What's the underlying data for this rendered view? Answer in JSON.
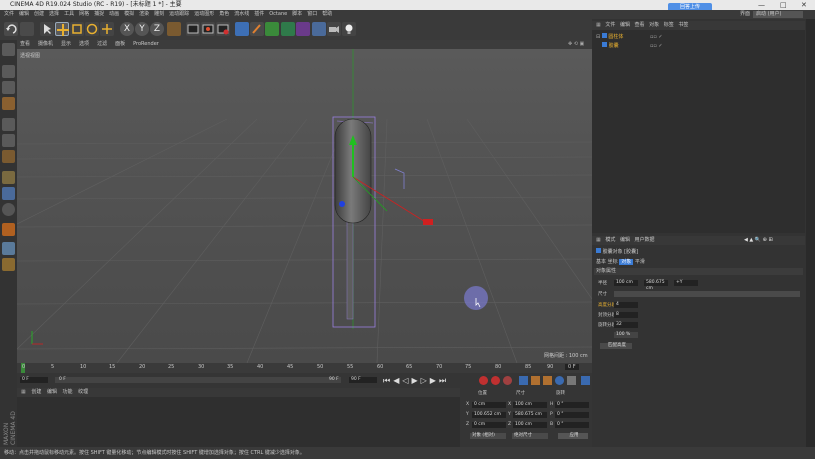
{
  "window": {
    "title": "CINEMA 4D R19.024 Studio (RC - R19) - [未标题 1 *] - 主要",
    "cloud_label": "回答上传"
  },
  "menubar": {
    "items": [
      "文件",
      "编辑",
      "创建",
      "选择",
      "工具",
      "网格",
      "捕捉",
      "动画",
      "模拟",
      "渲染",
      "雕刻",
      "运动跟踪",
      "运动图形",
      "角色",
      "流水线",
      "插件",
      "Octane",
      "脚本",
      "窗口",
      "帮助"
    ],
    "layout_label": "界面",
    "layout_value": "启动 (用户)"
  },
  "viewport": {
    "menu": [
      "查看",
      "摄像机",
      "显示",
      "选项",
      "过滤",
      "面板",
      "ProRender"
    ],
    "name": "透视视图",
    "grid_label": "网格间距 : 100 cm"
  },
  "timeline": {
    "ticks": [
      "0",
      "5",
      "10",
      "15",
      "20",
      "25",
      "30",
      "35",
      "40",
      "45",
      "50",
      "55",
      "60",
      "65",
      "70",
      "75",
      "80",
      "85",
      "90"
    ],
    "end_frame": "0 F",
    "start_field": "0 F",
    "min_field": "0 F",
    "max_field": "90 F",
    "end_field": "90 F"
  },
  "materials": {
    "menu": [
      "创建",
      "编辑",
      "功能",
      "纹理"
    ]
  },
  "coords": {
    "headers": [
      "位置",
      "尺寸",
      "旋转"
    ],
    "rows": [
      {
        "axis": "X",
        "pos": "0 cm",
        "size": "100 cm",
        "rot_label": "H",
        "rot": "0 °"
      },
      {
        "axis": "Y",
        "pos": "100.652 cm",
        "size": "580.675 cm",
        "rot_label": "P",
        "rot": "0 °"
      },
      {
        "axis": "Z",
        "pos": "0 cm",
        "size": "100 cm",
        "rot_label": "B",
        "rot": "0 °"
      }
    ],
    "mode1": "对象 (相对)",
    "mode2": "绝对尺寸",
    "apply": "应用"
  },
  "objects": {
    "menu": [
      "文件",
      "编辑",
      "查看",
      "对象",
      "标签",
      "书签"
    ],
    "items": [
      {
        "name": "圆柱体"
      },
      {
        "name": "胶囊"
      }
    ]
  },
  "attributes": {
    "menu": [
      "模式",
      "编辑",
      "用户数据"
    ],
    "header": "胶囊对象 [胶囊]",
    "tabs": [
      "基本",
      "坐标",
      "对象",
      "平滑"
    ],
    "section": "对象属性",
    "props": [
      {
        "label": "半径",
        "value": "100 cm"
      },
      {
        "label": "高度",
        "value": "580.675 cm"
      },
      {
        "label": "方向",
        "value": "+Y"
      }
    ],
    "fields": [
      {
        "label": "高度分段",
        "value": "4"
      },
      {
        "label": "封顶分段",
        "value": "8"
      },
      {
        "label": "旋转分段",
        "value": "32"
      }
    ],
    "extra_label": "尺寸",
    "button": "匹配高度",
    "slider": "100 %"
  },
  "status": {
    "text": "移动：点击并拖动鼠标移动元素。按住 SHIFT 键量化移动；节点编辑模式时按住 SHIFT 键增加选择对象；按住 CTRL 键减少选择对象。"
  },
  "colors": {
    "accent": "#3a7bd5",
    "x_axis": "#d02020",
    "y_axis": "#20c020",
    "z_axis": "#2040e0"
  }
}
